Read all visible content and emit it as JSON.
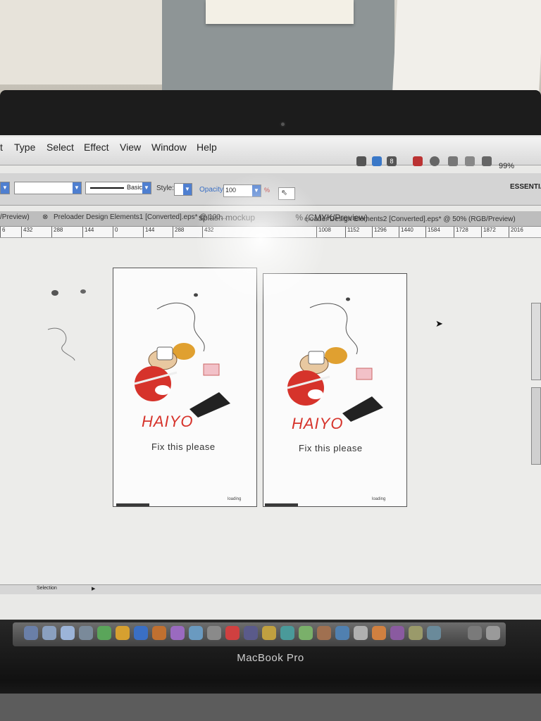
{
  "menu": {
    "items": [
      "t",
      "Type",
      "Select",
      "Effect",
      "View",
      "Window",
      "Help"
    ]
  },
  "tray": {
    "adobe_badge": "8",
    "battery": "99%"
  },
  "control": {
    "stroke_style": "Basic",
    "style_label": "Style:",
    "opacity_label": "Opacity:",
    "opacity_value": "100",
    "workspace": "ESSENTIA"
  },
  "tabs": {
    "left_partial": "/Preview)",
    "tab1": "Preloader Design Elements1 [Converted].eps* @ 100...",
    "doc_title": "splash mockup",
    "doc_title_suffix": "% (CMYK/Preview)",
    "tab3": "eloader Design Elements2 [Converted].eps* @ 50% (RGB/Preview)"
  },
  "ruler": {
    "ticks": [
      "6",
      "432",
      "288",
      "144",
      "0",
      "144",
      "288",
      "432",
      "1008",
      "1152",
      "1296",
      "1440",
      "1584",
      "1728",
      "1872",
      "2016"
    ]
  },
  "artboards": [
    {
      "logo": "HAIYO",
      "caption": "Fix this please",
      "loading": "loading",
      "progress": 0.23
    },
    {
      "logo": "HAIYO",
      "caption": "Fix this please",
      "loading": "loading",
      "progress": 0.23
    }
  ],
  "status": {
    "tool": "Selection"
  },
  "device": {
    "brand": "MacBook Pro"
  },
  "colors": {
    "logo_red": "#d6332b",
    "accent_blue": "#4f7fd0"
  }
}
